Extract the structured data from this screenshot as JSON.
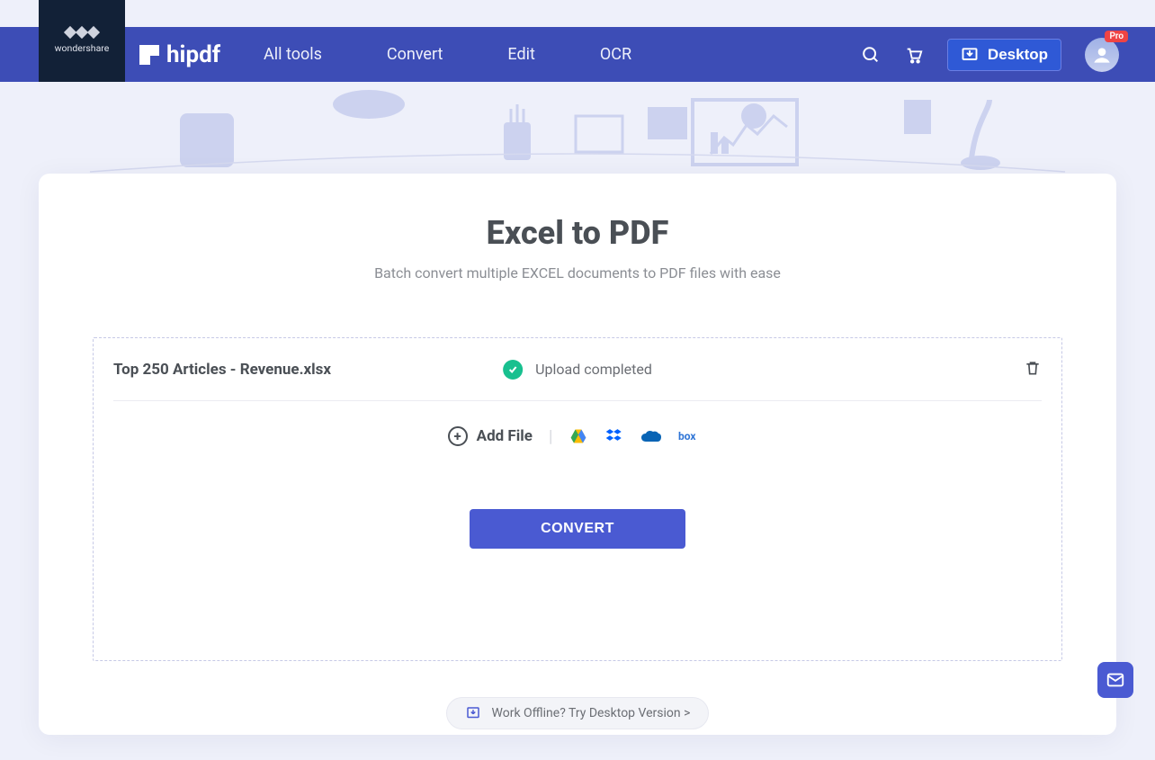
{
  "brand": {
    "parent": "wondershare",
    "name": "hipdf"
  },
  "nav": {
    "all_tools": "All tools",
    "convert": "Convert",
    "edit": "Edit",
    "ocr": "OCR"
  },
  "header": {
    "desktop_label": "Desktop",
    "pro_badge": "Pro"
  },
  "page": {
    "title": "Excel to PDF",
    "subtitle": "Batch convert multiple EXCEL documents to PDF files with ease"
  },
  "file": {
    "name": "Top 250 Articles - Revenue.xlsx",
    "status": "Upload completed"
  },
  "actions": {
    "add_file": "Add File",
    "convert": "CONVERT"
  },
  "offline": {
    "text": "Work Offline? Try Desktop Version >"
  },
  "cloud_providers": [
    "google-drive",
    "dropbox",
    "onedrive",
    "box"
  ]
}
